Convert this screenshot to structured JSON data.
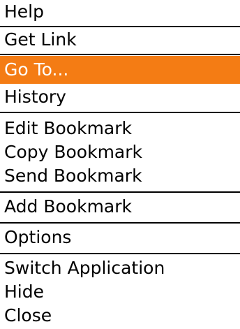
{
  "menu": {
    "items": [
      {
        "label": "Help"
      },
      {
        "label": "Get Link"
      },
      {
        "label": "Go To..."
      },
      {
        "label": "History"
      },
      {
        "label": "Edit Bookmark"
      },
      {
        "label": "Copy Bookmark"
      },
      {
        "label": "Send Bookmark"
      },
      {
        "label": "Add Bookmark"
      },
      {
        "label": "Options"
      },
      {
        "label": "Switch Application"
      },
      {
        "label": "Hide"
      },
      {
        "label": "Close"
      }
    ],
    "selected_item": "Go To...",
    "highlight_color": "#f47c14"
  }
}
